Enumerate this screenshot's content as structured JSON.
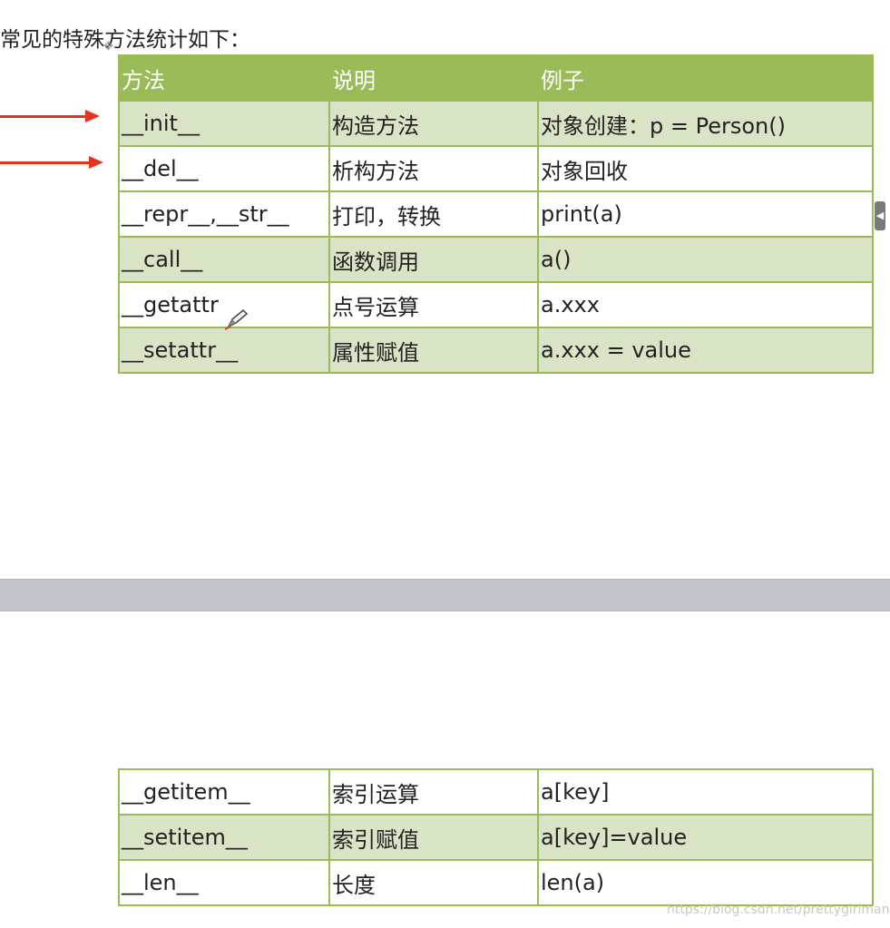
{
  "heading": "常见的特殊方法统计如下：",
  "table_top": {
    "headers": [
      "方法",
      "说明",
      "例子"
    ],
    "rows": [
      [
        "__init__",
        "构造方法",
        "对象创建：p = Person()"
      ],
      [
        "__del__",
        "析构方法",
        "对象回收"
      ],
      [
        "__repr__,__str__",
        "打印，转换",
        "print(a)"
      ],
      [
        "__call__",
        "函数调用",
        "a()"
      ],
      [
        "__getattr",
        "点号运算",
        "a.xxx"
      ],
      [
        "__setattr__",
        "属性赋值",
        "a.xxx = value"
      ]
    ]
  },
  "table_bottom": {
    "rows": [
      [
        "__getitem__",
        "索引运算",
        "a[key]"
      ],
      [
        "__setitem__",
        "索引赋值",
        "a[key]=value"
      ],
      [
        "__len__",
        "长度",
        "len(a)"
      ]
    ]
  },
  "watermark": "https://blog.csdn.net/prettygirlman",
  "colors": {
    "header_bg": "#9bbb59",
    "row_alt_bg": "#d9e3c5",
    "arrow": "#e8321e",
    "divider": "#c3c4cc"
  },
  "icons": [
    "move-handle-icon",
    "pen-cursor-icon",
    "side-tab-icon"
  ]
}
